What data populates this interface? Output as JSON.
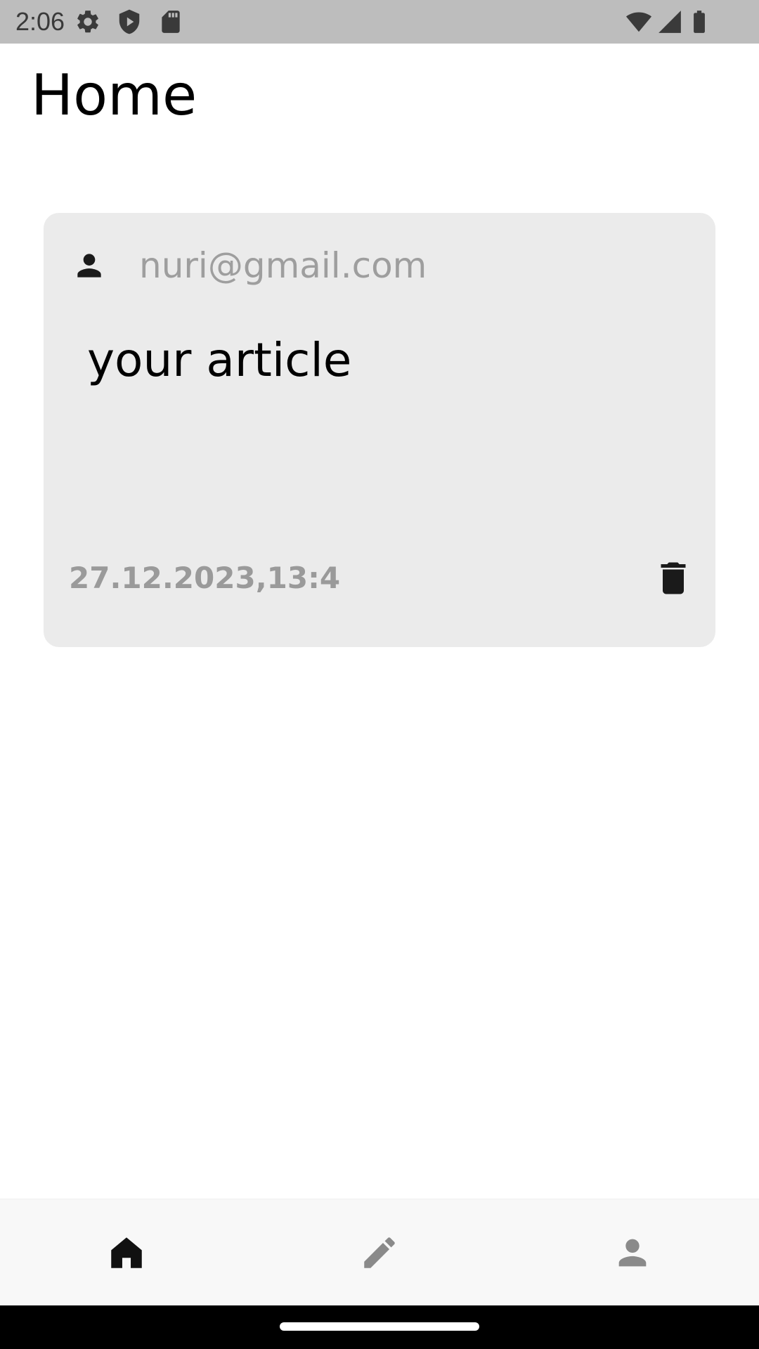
{
  "status_bar": {
    "time": "2:06",
    "icons_left": [
      "settings-icon",
      "shield-icon",
      "sd-card-icon"
    ],
    "icons_right": [
      "wifi-icon",
      "signal-icon",
      "battery-icon"
    ]
  },
  "header": {
    "title": "Home"
  },
  "post": {
    "author": "nuri@gmail.com",
    "content": "your article",
    "date": "27.12.2023,13:4",
    "card_color": "#ebebeb"
  },
  "bottom_nav": {
    "items": [
      {
        "name": "home",
        "icon": "home-icon",
        "active": true
      },
      {
        "name": "write",
        "icon": "pencil-icon",
        "active": false
      },
      {
        "name": "profile",
        "icon": "person-icon",
        "active": false
      }
    ],
    "active_color": "#111111",
    "inactive_color": "#8a8a8a"
  }
}
